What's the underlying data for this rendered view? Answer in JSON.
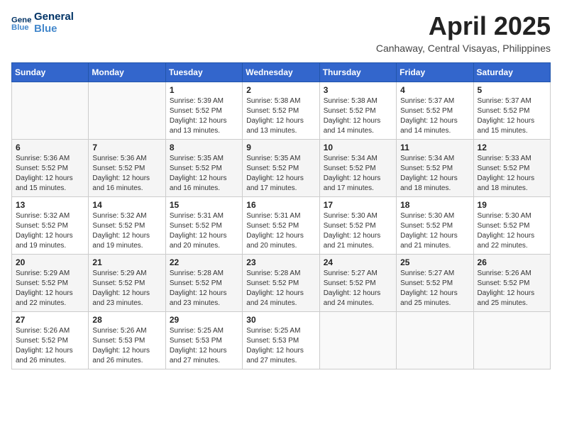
{
  "logo": {
    "line1": "General",
    "line2": "Blue"
  },
  "title": "April 2025",
  "location": "Canhaway, Central Visayas, Philippines",
  "weekdays": [
    "Sunday",
    "Monday",
    "Tuesday",
    "Wednesday",
    "Thursday",
    "Friday",
    "Saturday"
  ],
  "weeks": [
    [
      {
        "day": "",
        "info": ""
      },
      {
        "day": "",
        "info": ""
      },
      {
        "day": "1",
        "info": "Sunrise: 5:39 AM\nSunset: 5:52 PM\nDaylight: 12 hours\nand 13 minutes."
      },
      {
        "day": "2",
        "info": "Sunrise: 5:38 AM\nSunset: 5:52 PM\nDaylight: 12 hours\nand 13 minutes."
      },
      {
        "day": "3",
        "info": "Sunrise: 5:38 AM\nSunset: 5:52 PM\nDaylight: 12 hours\nand 14 minutes."
      },
      {
        "day": "4",
        "info": "Sunrise: 5:37 AM\nSunset: 5:52 PM\nDaylight: 12 hours\nand 14 minutes."
      },
      {
        "day": "5",
        "info": "Sunrise: 5:37 AM\nSunset: 5:52 PM\nDaylight: 12 hours\nand 15 minutes."
      }
    ],
    [
      {
        "day": "6",
        "info": "Sunrise: 5:36 AM\nSunset: 5:52 PM\nDaylight: 12 hours\nand 15 minutes."
      },
      {
        "day": "7",
        "info": "Sunrise: 5:36 AM\nSunset: 5:52 PM\nDaylight: 12 hours\nand 16 minutes."
      },
      {
        "day": "8",
        "info": "Sunrise: 5:35 AM\nSunset: 5:52 PM\nDaylight: 12 hours\nand 16 minutes."
      },
      {
        "day": "9",
        "info": "Sunrise: 5:35 AM\nSunset: 5:52 PM\nDaylight: 12 hours\nand 17 minutes."
      },
      {
        "day": "10",
        "info": "Sunrise: 5:34 AM\nSunset: 5:52 PM\nDaylight: 12 hours\nand 17 minutes."
      },
      {
        "day": "11",
        "info": "Sunrise: 5:34 AM\nSunset: 5:52 PM\nDaylight: 12 hours\nand 18 minutes."
      },
      {
        "day": "12",
        "info": "Sunrise: 5:33 AM\nSunset: 5:52 PM\nDaylight: 12 hours\nand 18 minutes."
      }
    ],
    [
      {
        "day": "13",
        "info": "Sunrise: 5:32 AM\nSunset: 5:52 PM\nDaylight: 12 hours\nand 19 minutes."
      },
      {
        "day": "14",
        "info": "Sunrise: 5:32 AM\nSunset: 5:52 PM\nDaylight: 12 hours\nand 19 minutes."
      },
      {
        "day": "15",
        "info": "Sunrise: 5:31 AM\nSunset: 5:52 PM\nDaylight: 12 hours\nand 20 minutes."
      },
      {
        "day": "16",
        "info": "Sunrise: 5:31 AM\nSunset: 5:52 PM\nDaylight: 12 hours\nand 20 minutes."
      },
      {
        "day": "17",
        "info": "Sunrise: 5:30 AM\nSunset: 5:52 PM\nDaylight: 12 hours\nand 21 minutes."
      },
      {
        "day": "18",
        "info": "Sunrise: 5:30 AM\nSunset: 5:52 PM\nDaylight: 12 hours\nand 21 minutes."
      },
      {
        "day": "19",
        "info": "Sunrise: 5:30 AM\nSunset: 5:52 PM\nDaylight: 12 hours\nand 22 minutes."
      }
    ],
    [
      {
        "day": "20",
        "info": "Sunrise: 5:29 AM\nSunset: 5:52 PM\nDaylight: 12 hours\nand 22 minutes."
      },
      {
        "day": "21",
        "info": "Sunrise: 5:29 AM\nSunset: 5:52 PM\nDaylight: 12 hours\nand 23 minutes."
      },
      {
        "day": "22",
        "info": "Sunrise: 5:28 AM\nSunset: 5:52 PM\nDaylight: 12 hours\nand 23 minutes."
      },
      {
        "day": "23",
        "info": "Sunrise: 5:28 AM\nSunset: 5:52 PM\nDaylight: 12 hours\nand 24 minutes."
      },
      {
        "day": "24",
        "info": "Sunrise: 5:27 AM\nSunset: 5:52 PM\nDaylight: 12 hours\nand 24 minutes."
      },
      {
        "day": "25",
        "info": "Sunrise: 5:27 AM\nSunset: 5:52 PM\nDaylight: 12 hours\nand 25 minutes."
      },
      {
        "day": "26",
        "info": "Sunrise: 5:26 AM\nSunset: 5:52 PM\nDaylight: 12 hours\nand 25 minutes."
      }
    ],
    [
      {
        "day": "27",
        "info": "Sunrise: 5:26 AM\nSunset: 5:52 PM\nDaylight: 12 hours\nand 26 minutes."
      },
      {
        "day": "28",
        "info": "Sunrise: 5:26 AM\nSunset: 5:53 PM\nDaylight: 12 hours\nand 26 minutes."
      },
      {
        "day": "29",
        "info": "Sunrise: 5:25 AM\nSunset: 5:53 PM\nDaylight: 12 hours\nand 27 minutes."
      },
      {
        "day": "30",
        "info": "Sunrise: 5:25 AM\nSunset: 5:53 PM\nDaylight: 12 hours\nand 27 minutes."
      },
      {
        "day": "",
        "info": ""
      },
      {
        "day": "",
        "info": ""
      },
      {
        "day": "",
        "info": ""
      }
    ]
  ]
}
